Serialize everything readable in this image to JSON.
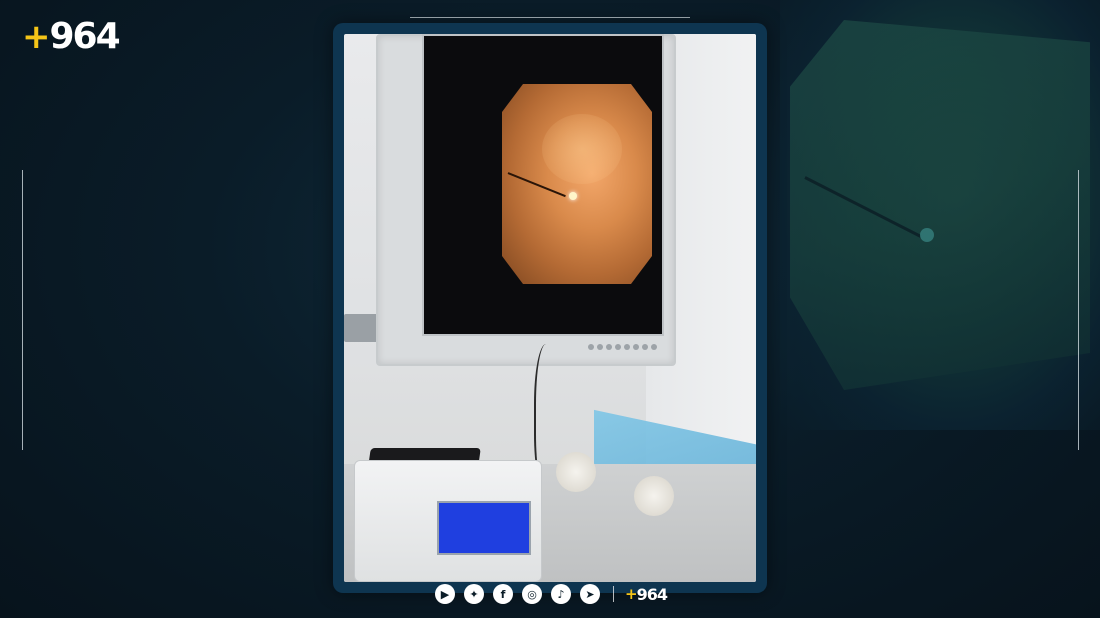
{
  "brand": {
    "logo_plus": "+",
    "logo_number": "964",
    "accent_color": "#f5c518",
    "background_color": "#0a1c28",
    "frame_color": "#0e3550"
  },
  "photo": {
    "subject": "",
    "icons": []
  },
  "social": {
    "icons": [
      {
        "name": "youtube-icon",
        "glyph": "▶"
      },
      {
        "name": "twitter-icon",
        "glyph": "✦"
      },
      {
        "name": "facebook-icon",
        "glyph": "f"
      },
      {
        "name": "instagram-icon",
        "glyph": "◎"
      },
      {
        "name": "tiktok-icon",
        "glyph": "♪"
      },
      {
        "name": "telegram-icon",
        "glyph": "➤"
      }
    ],
    "brand_plus": "+",
    "brand_number": "964"
  }
}
